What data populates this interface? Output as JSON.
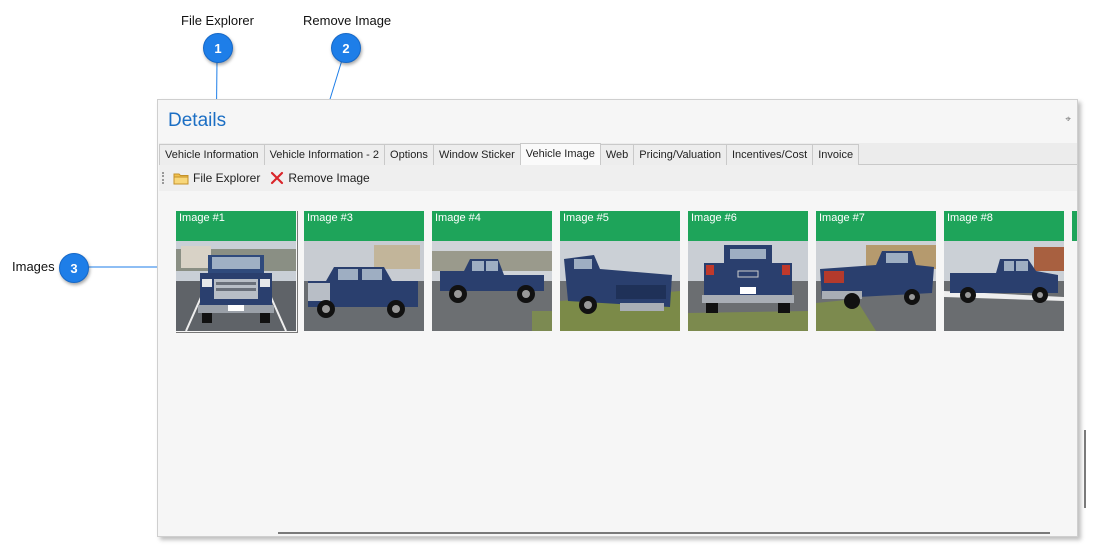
{
  "callouts": [
    {
      "label": "File Explorer",
      "number": "1"
    },
    {
      "label": "Remove Image",
      "number": "2"
    },
    {
      "label": "Images",
      "number": "3"
    }
  ],
  "panel": {
    "title": "Details",
    "pin": "⌖"
  },
  "tabs": [
    {
      "label": "Vehicle Information",
      "active": false
    },
    {
      "label": "Vehicle Information - 2",
      "active": false
    },
    {
      "label": "Options",
      "active": false
    },
    {
      "label": "Window Sticker",
      "active": false
    },
    {
      "label": "Vehicle Image",
      "active": true
    },
    {
      "label": "Web",
      "active": false
    },
    {
      "label": "Pricing/Valuation",
      "active": false
    },
    {
      "label": "Incentives/Cost",
      "active": false
    },
    {
      "label": "Invoice",
      "active": false
    }
  ],
  "toolbar": {
    "file_explorer": {
      "label": "File Explorer",
      "icon": "folder-icon"
    },
    "remove_image": {
      "label": "Remove Image",
      "icon": "close-x-icon"
    }
  },
  "images": [
    {
      "caption": "Image #1",
      "view": "front",
      "selected": true
    },
    {
      "caption": "Image #3",
      "view": "front-left",
      "selected": false
    },
    {
      "caption": "Image #4",
      "view": "side-left",
      "selected": false
    },
    {
      "caption": "Image #5",
      "view": "rear-right",
      "selected": false
    },
    {
      "caption": "Image #6",
      "view": "rear",
      "selected": false
    },
    {
      "caption": "Image #7",
      "view": "rear-left",
      "selected": false
    },
    {
      "caption": "Image #8",
      "view": "side-right",
      "selected": false
    }
  ],
  "colors": {
    "accent": "#1e7ee8",
    "title": "#1c6fc4",
    "caption_bg": "#1ea45a",
    "truck": "#2a3f6e"
  }
}
